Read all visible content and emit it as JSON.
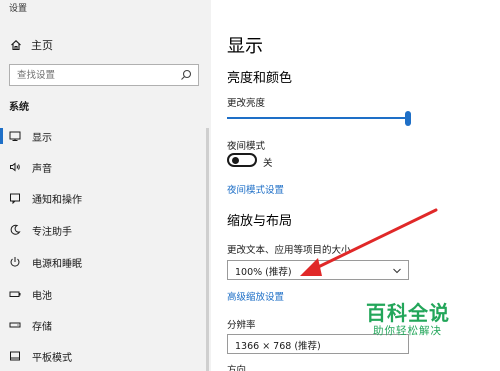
{
  "window": {
    "title": "设置"
  },
  "sidebar": {
    "home_label": "主页",
    "search_placeholder": "查找设置",
    "section_label": "系统",
    "items": [
      {
        "label": "显示",
        "icon": "monitor-icon",
        "active": true
      },
      {
        "label": "声音",
        "icon": "speaker-icon"
      },
      {
        "label": "通知和操作",
        "icon": "notification-icon"
      },
      {
        "label": "专注助手",
        "icon": "moon-icon"
      },
      {
        "label": "电源和睡眠",
        "icon": "power-icon"
      },
      {
        "label": "电池",
        "icon": "battery-icon"
      },
      {
        "label": "存储",
        "icon": "storage-icon"
      },
      {
        "label": "平板模式",
        "icon": "tablet-icon"
      }
    ]
  },
  "main": {
    "title": "显示",
    "brightness_section": {
      "heading": "亮度和颜色",
      "brightness_label": "更改亮度",
      "brightness_value": 1.0,
      "night_mode_label": "夜间模式",
      "night_mode_state": "关",
      "night_mode_link": "夜间模式设置"
    },
    "scale_section": {
      "heading": "缩放与布局",
      "scale_label": "更改文本、应用等项目的大小",
      "scale_value": "100% (推荐)",
      "advanced_link": "高级缩放设置",
      "resolution_label": "分辨率",
      "resolution_value": "1366 × 768 (推荐)",
      "orientation_label": "方向"
    }
  },
  "watermark": {
    "logo": "百科全说",
    "tagline": "助你轻松解决"
  },
  "colors": {
    "accent": "#1e6fc7",
    "arrow": "#e02828",
    "watermark": "#23a65a"
  }
}
